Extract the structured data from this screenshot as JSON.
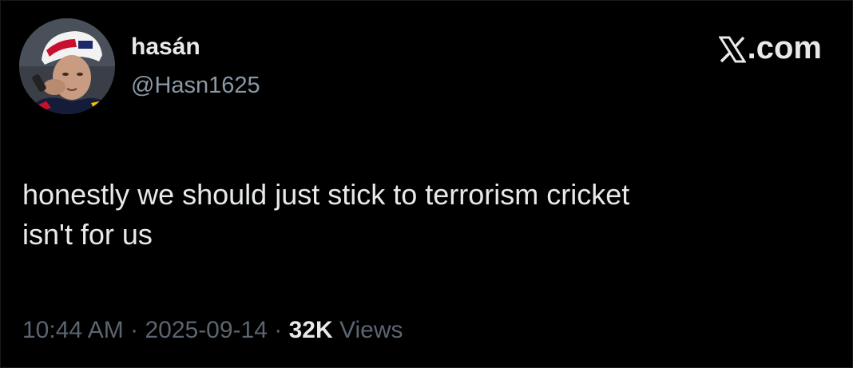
{
  "author": {
    "display_name": "hasán",
    "handle": "@Hasn1625",
    "avatar_icon": "profile-photo-avatar"
  },
  "brand": {
    "icon": "x-logo-icon",
    "label": ".com"
  },
  "tweet": {
    "text": "honestly we should just stick to terrorism cricket\nisn't for us"
  },
  "meta": {
    "time": "10:44 AM",
    "separator": "·",
    "date": "2025-09-14",
    "views_count": "32K",
    "views_label": "Views"
  },
  "colors": {
    "background": "#000000",
    "text_primary": "#e7e9ea",
    "text_secondary": "#8b98a5",
    "meta_muted": "#5b6570"
  }
}
